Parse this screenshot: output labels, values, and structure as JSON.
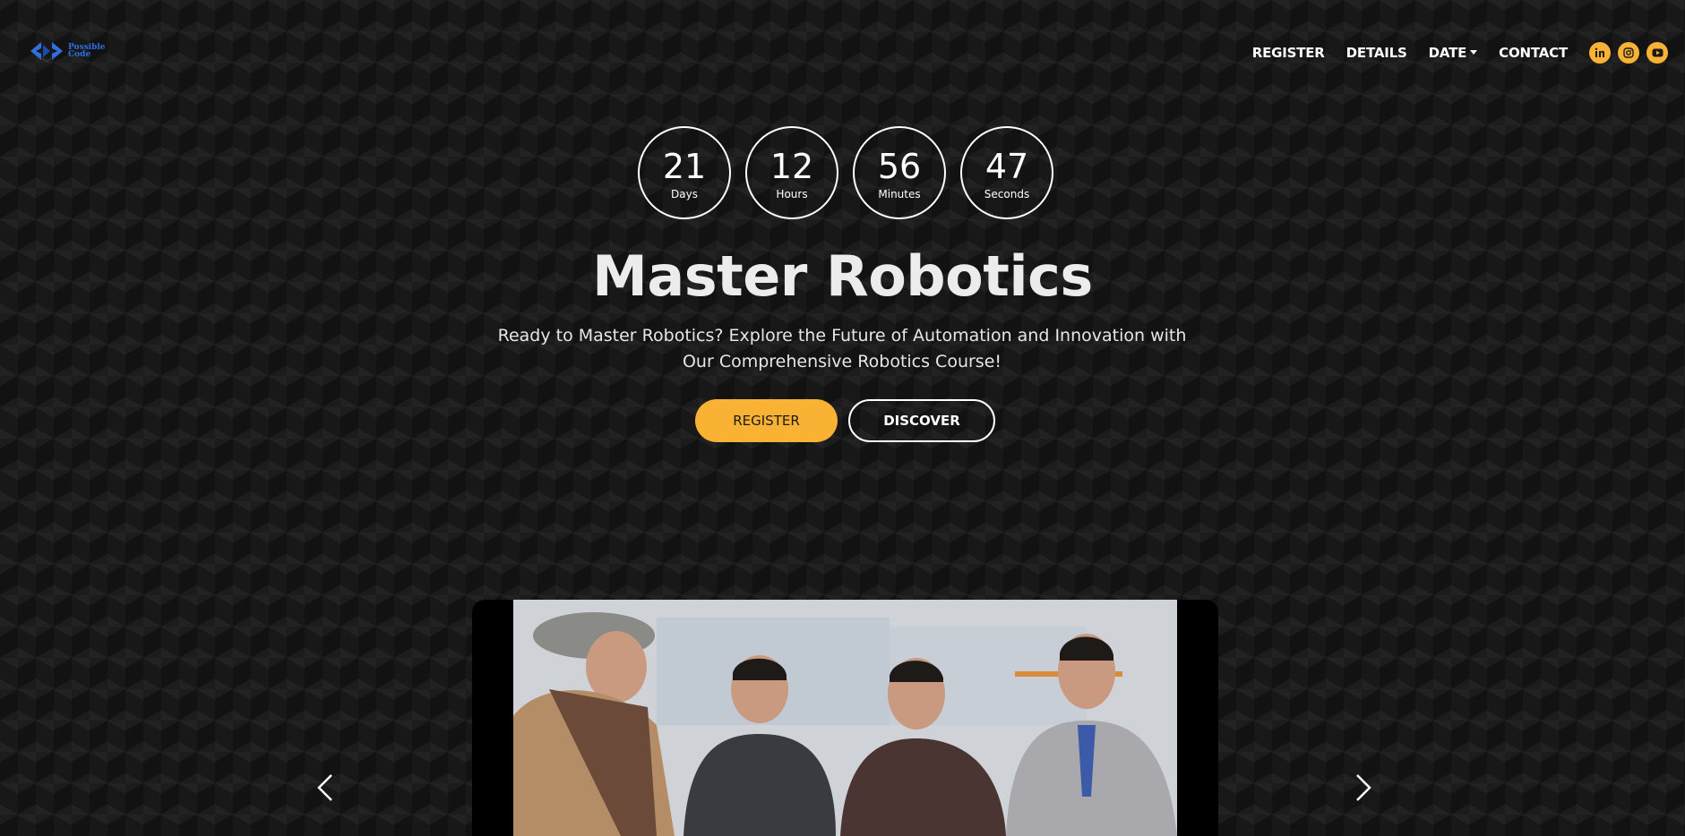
{
  "brand": {
    "logo_line1": "Possible",
    "logo_line2": "Code"
  },
  "nav": {
    "links": [
      "REGISTER",
      "DETAILS",
      "DATE",
      "CONTACT"
    ],
    "socials": [
      "linkedin-icon",
      "instagram-icon",
      "youtube-icon"
    ]
  },
  "countdown": [
    {
      "value": "21",
      "label": "Days"
    },
    {
      "value": "12",
      "label": "Hours"
    },
    {
      "value": "56",
      "label": "Minutes"
    },
    {
      "value": "47",
      "label": "Seconds"
    }
  ],
  "hero": {
    "title": "Master Robotics",
    "subtitle": "Ready to Master Robotics? Explore the Future of Automation and Innovation with Our Comprehensive Robotics Course!",
    "register_label": "REGISTER",
    "discover_label": "DISCOVER"
  },
  "colors": {
    "accent": "#f9b233",
    "background": "#121212",
    "logo": "#2f6fe0"
  }
}
